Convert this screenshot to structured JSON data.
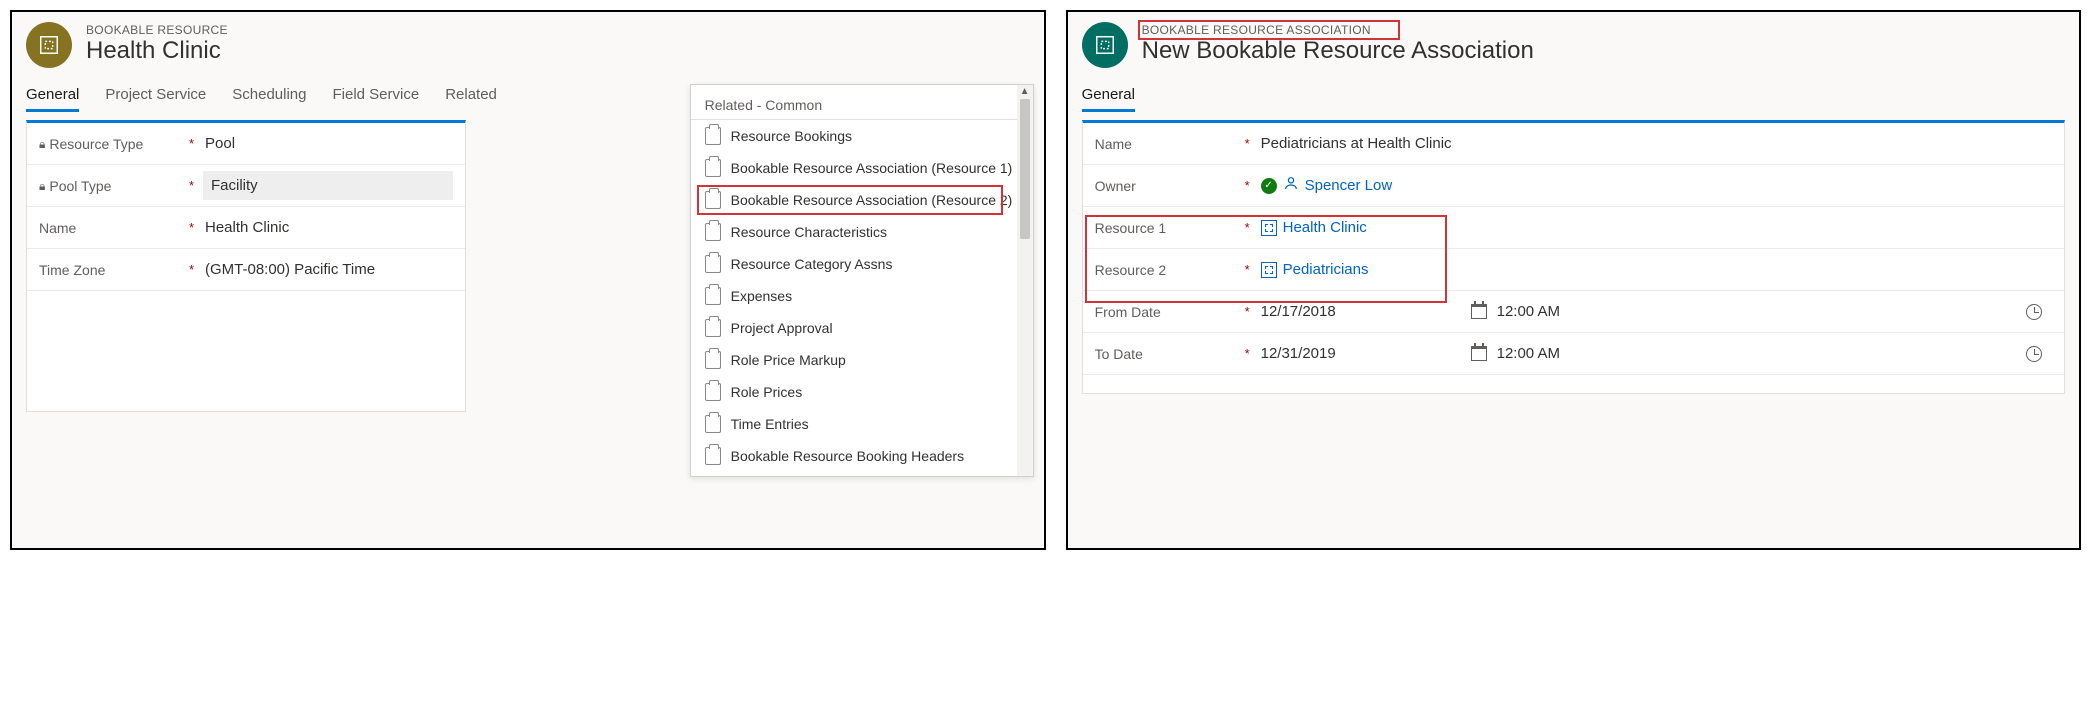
{
  "left": {
    "entity_type": "BOOKABLE RESOURCE",
    "title": "Health Clinic",
    "tabs": [
      "General",
      "Project Service",
      "Scheduling",
      "Field Service",
      "Related"
    ],
    "active_tab": 0,
    "fields": {
      "resource_type": {
        "label": "Resource Type",
        "value": "Pool",
        "locked": true,
        "required": true
      },
      "pool_type": {
        "label": "Pool Type",
        "value": "Facility",
        "locked": true,
        "required": true,
        "highlighted": true
      },
      "name": {
        "label": "Name",
        "value": "Health Clinic",
        "required": true
      },
      "time_zone": {
        "label": "Time Zone",
        "value": "(GMT-08:00) Pacific Time",
        "required": true
      }
    },
    "related_menu": {
      "header": "Related - Common",
      "items": [
        "Resource Bookings",
        "Bookable Resource Association (Resource 1)",
        "Bookable Resource Association (Resource 2)",
        "Resource Characteristics",
        "Resource Category Assns",
        "Expenses",
        "Project Approval",
        "Role Price Markup",
        "Role Prices",
        "Time Entries",
        "Bookable Resource Booking Headers"
      ],
      "highlighted_index": 2
    }
  },
  "right": {
    "entity_type": "BOOKABLE RESOURCE ASSOCIATION",
    "title": "New Bookable Resource Association",
    "tab": "General",
    "fields": {
      "name": {
        "label": "Name",
        "value": "Pediatricians at Health Clinic",
        "required": true
      },
      "owner": {
        "label": "Owner",
        "value": "Spencer Low",
        "required": true
      },
      "resource1": {
        "label": "Resource 1",
        "value": "Health Clinic",
        "required": true
      },
      "resource2": {
        "label": "Resource 2",
        "value": "Pediatricians",
        "required": true
      },
      "from_date": {
        "label": "From Date",
        "date": "12/17/2018",
        "time": "12:00 AM",
        "required": true
      },
      "to_date": {
        "label": "To Date",
        "date": "12/31/2019",
        "time": "12:00 AM",
        "required": true
      }
    }
  }
}
